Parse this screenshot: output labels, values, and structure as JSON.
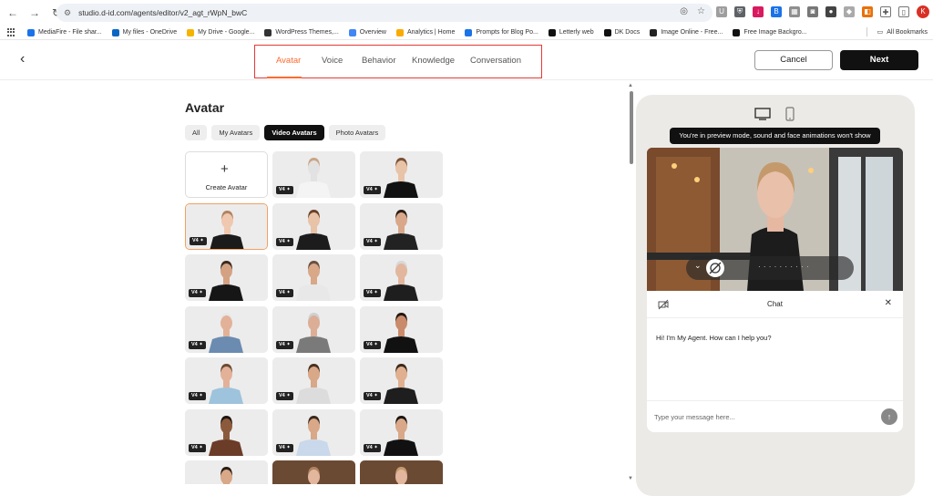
{
  "browser": {
    "url": "studio.d-id.com/agents/editor/v2_agt_rWpN_bwC",
    "profile_initial": "K",
    "bookmarks": [
      {
        "label": "MediaFire - File shar...",
        "color": "#1a73e8"
      },
      {
        "label": "My files - OneDrive",
        "color": "#0a66c2"
      },
      {
        "label": "My Drive - Google...",
        "color": "#f4b400"
      },
      {
        "label": "WordPress Themes,...",
        "color": "#333333"
      },
      {
        "label": "Overview",
        "color": "#4285f4"
      },
      {
        "label": "Analytics | Home",
        "color": "#f9ab00"
      },
      {
        "label": "Prompts for Blog Po...",
        "color": "#1a73e8"
      },
      {
        "label": "Letterly web",
        "color": "#111111"
      },
      {
        "label": "DK Docs",
        "color": "#111111"
      },
      {
        "label": "Image Online - Free...",
        "color": "#222222"
      },
      {
        "label": "Free Image Backgro...",
        "color": "#111111"
      }
    ],
    "all_bookmarks": "All Bookmarks"
  },
  "header": {
    "tabs": [
      "Avatar",
      "Voice",
      "Behavior",
      "Knowledge",
      "Conversation"
    ],
    "active_tab": "Avatar",
    "cancel_label": "Cancel",
    "next_label": "Next"
  },
  "avatar": {
    "title": "Avatar",
    "filters": [
      "All",
      "My Avatars",
      "Video Avatars",
      "Photo Avatars"
    ],
    "active_filter": "Video Avatars",
    "create_label": "Create Avatar",
    "badge": "V4 ✦"
  },
  "preview": {
    "tooltip": "You're in preview mode, sound and face animations won't show",
    "chat_title": "Chat",
    "greeting": "Hi! I'm My Agent. How can I help you?",
    "input_placeholder": "Type your message here...",
    "video_dots": "· · · · · · · · · ·"
  },
  "colors": {
    "accent": "#ff6a2e",
    "highlight_box": "#e53935",
    "dark": "#111111"
  }
}
